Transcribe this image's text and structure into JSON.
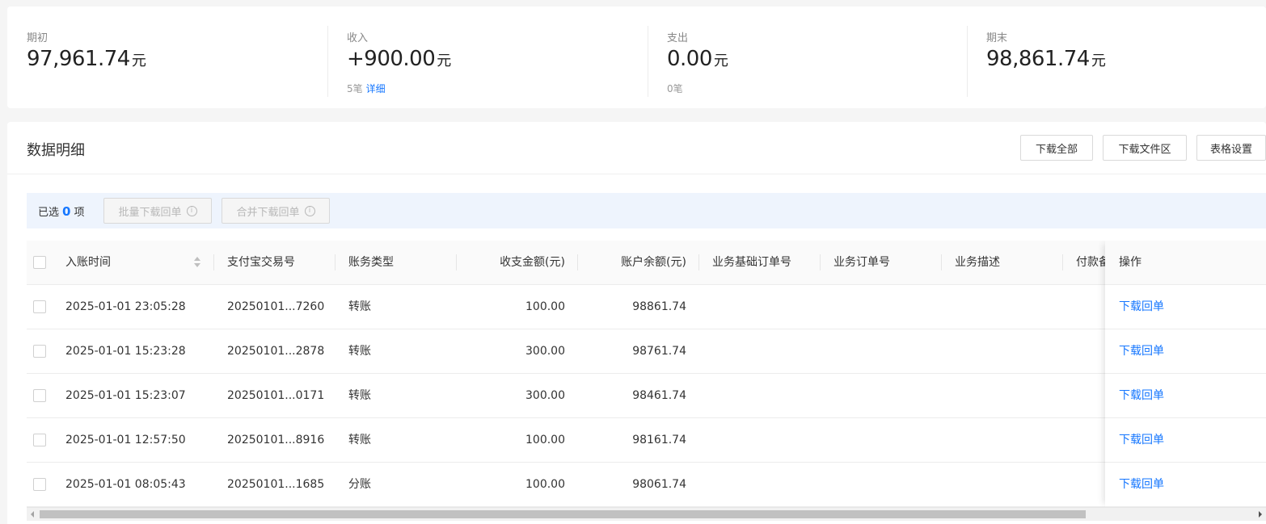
{
  "summary": {
    "opening": {
      "label": "期初",
      "amount": "97,961.74",
      "unit": "元"
    },
    "income": {
      "label": "收入",
      "amount": "+900.00",
      "unit": "元",
      "count": "5笔",
      "detail_link": "详细"
    },
    "expense": {
      "label": "支出",
      "amount": "0.00",
      "unit": "元",
      "count": "0笔"
    },
    "closing": {
      "label": "期末",
      "amount": "98,861.74",
      "unit": "元"
    }
  },
  "panel": {
    "title": "数据明细",
    "buttons": {
      "download_all": "下载全部",
      "download_folder": "下载文件区",
      "table_settings": "表格设置"
    }
  },
  "selection": {
    "prefix": "已选",
    "count": "0",
    "suffix": "项",
    "batch_download": "批量下载回单",
    "merge_download": "合并下载回单",
    "info_glyph": "i"
  },
  "table": {
    "columns": {
      "time": "入账时间",
      "alipay_no": "支付宝交易号",
      "type": "账务类型",
      "amount": "收支金额(元)",
      "balance": "账户余额(元)",
      "base_order": "业务基础订单号",
      "order": "业务订单号",
      "desc": "业务描述",
      "payment_note": "付款备",
      "action": "操作"
    },
    "rows": [
      {
        "time": "2025-01-01 23:05:28",
        "alipay_no": "20250101...7260",
        "type": "转账",
        "amount": "100.00",
        "balance": "98861.74",
        "action": "下载回单"
      },
      {
        "time": "2025-01-01 15:23:28",
        "alipay_no": "20250101...2878",
        "type": "转账",
        "amount": "300.00",
        "balance": "98761.74",
        "action": "下载回单"
      },
      {
        "time": "2025-01-01 15:23:07",
        "alipay_no": "20250101...0171",
        "type": "转账",
        "amount": "300.00",
        "balance": "98461.74",
        "action": "下载回单"
      },
      {
        "time": "2025-01-01 12:57:50",
        "alipay_no": "20250101...8916",
        "type": "转账",
        "amount": "100.00",
        "balance": "98161.74",
        "action": "下载回单"
      },
      {
        "time": "2025-01-01 08:05:43",
        "alipay_no": "20250101...1685",
        "type": "分账",
        "amount": "100.00",
        "balance": "98061.74",
        "action": "下载回单"
      }
    ]
  },
  "colors": {
    "accent": "#1677ff",
    "select_bar_bg": "#eef4fd"
  }
}
